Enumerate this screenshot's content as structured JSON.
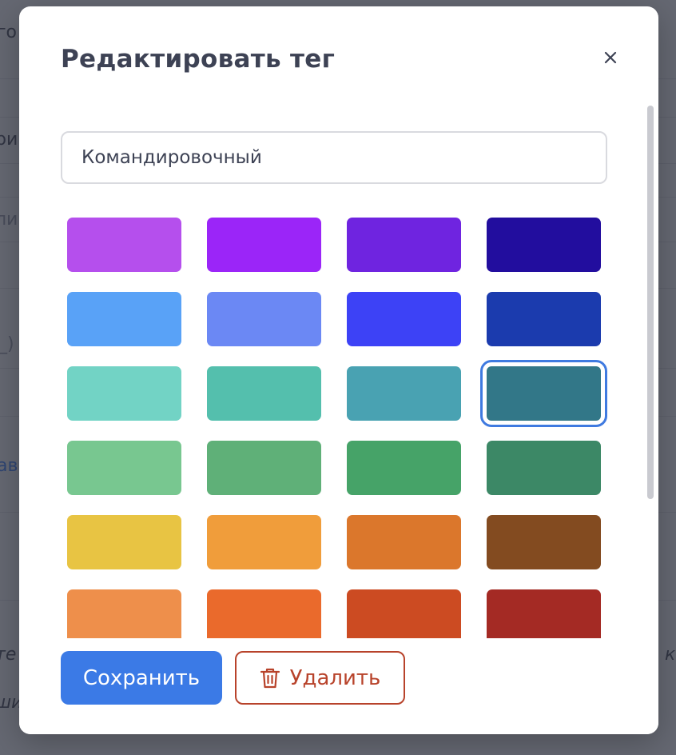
{
  "modal": {
    "title": "Редактировать тег",
    "close_icon": "close-icon"
  },
  "form": {
    "tag_name": "Командировочный"
  },
  "palette": {
    "selected_index": 11,
    "colors": [
      "#b54fed",
      "#9b25f8",
      "#6f24e0",
      "#220d9e",
      "#59a2f7",
      "#6b88f4",
      "#3d42f6",
      "#1b3bae",
      "#72d3c5",
      "#54bfad",
      "#49a2b2",
      "#327788",
      "#78c790",
      "#5fb078",
      "#46a368",
      "#3c8866",
      "#e8c443",
      "#f09d3b",
      "#db772c",
      "#834b20",
      "#ee8f4b",
      "#ea6a2c",
      "#cc4b22",
      "#a42a24"
    ]
  },
  "footer": {
    "save_label": "Сохранить",
    "delete_label": "Удалить",
    "delete_icon": "trash-icon"
  },
  "background": {
    "fragments": [
      "го",
      "ри",
      "ли",
      "_)",
      "ав",
      "те",
      "ши",
      "к"
    ]
  }
}
